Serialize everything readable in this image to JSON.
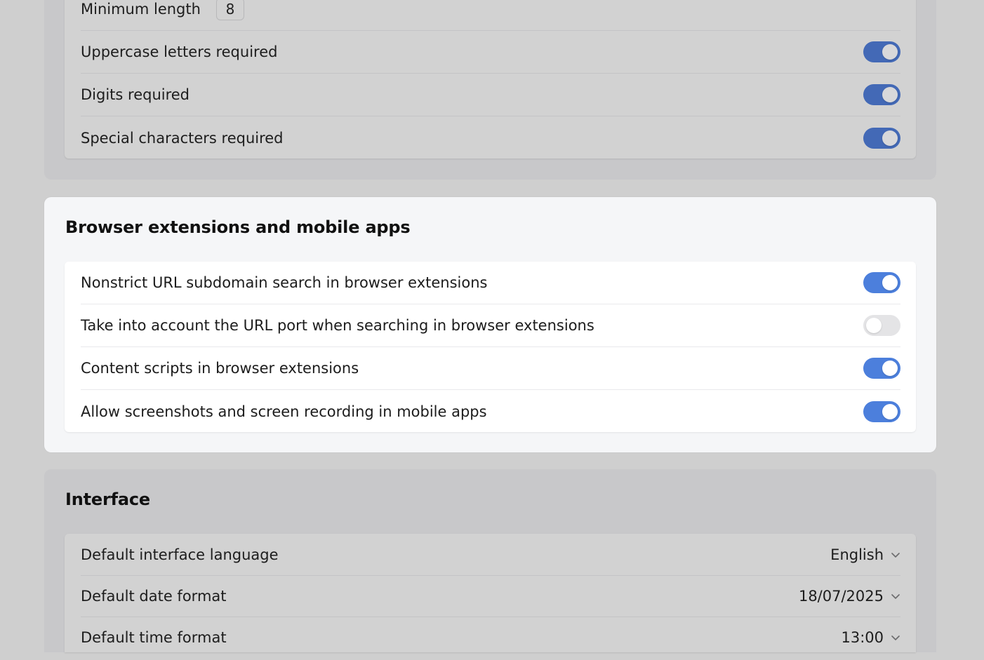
{
  "password_policy": {
    "min_length_label": "Minimum length",
    "min_length_value": "8",
    "rows": [
      {
        "label": "Uppercase letters required",
        "on": true
      },
      {
        "label": "Digits required",
        "on": true
      },
      {
        "label": "Special characters required",
        "on": true
      }
    ]
  },
  "browser_extensions": {
    "title": "Browser extensions and mobile apps",
    "rows": [
      {
        "label": "Nonstrict URL subdomain search in browser extensions",
        "on": true
      },
      {
        "label": "Take into account the URL port when searching in browser extensions",
        "on": false
      },
      {
        "label": "Content scripts in browser extensions",
        "on": true
      },
      {
        "label": "Allow screenshots and screen recording in mobile apps",
        "on": true
      }
    ]
  },
  "interface": {
    "title": "Interface",
    "rows": [
      {
        "label": "Default interface language",
        "value": "English"
      },
      {
        "label": "Default date format",
        "value": "18/07/2025"
      },
      {
        "label": "Default time format",
        "value": "13:00"
      }
    ]
  },
  "colors": {
    "toggle_on": "#4c7fdc",
    "toggle_off": "#e4e4e6",
    "overlay_bg": "#cfcfcf"
  },
  "icons": {
    "toggle_knob": "circle",
    "dropdown": "chevron-down-icon"
  }
}
